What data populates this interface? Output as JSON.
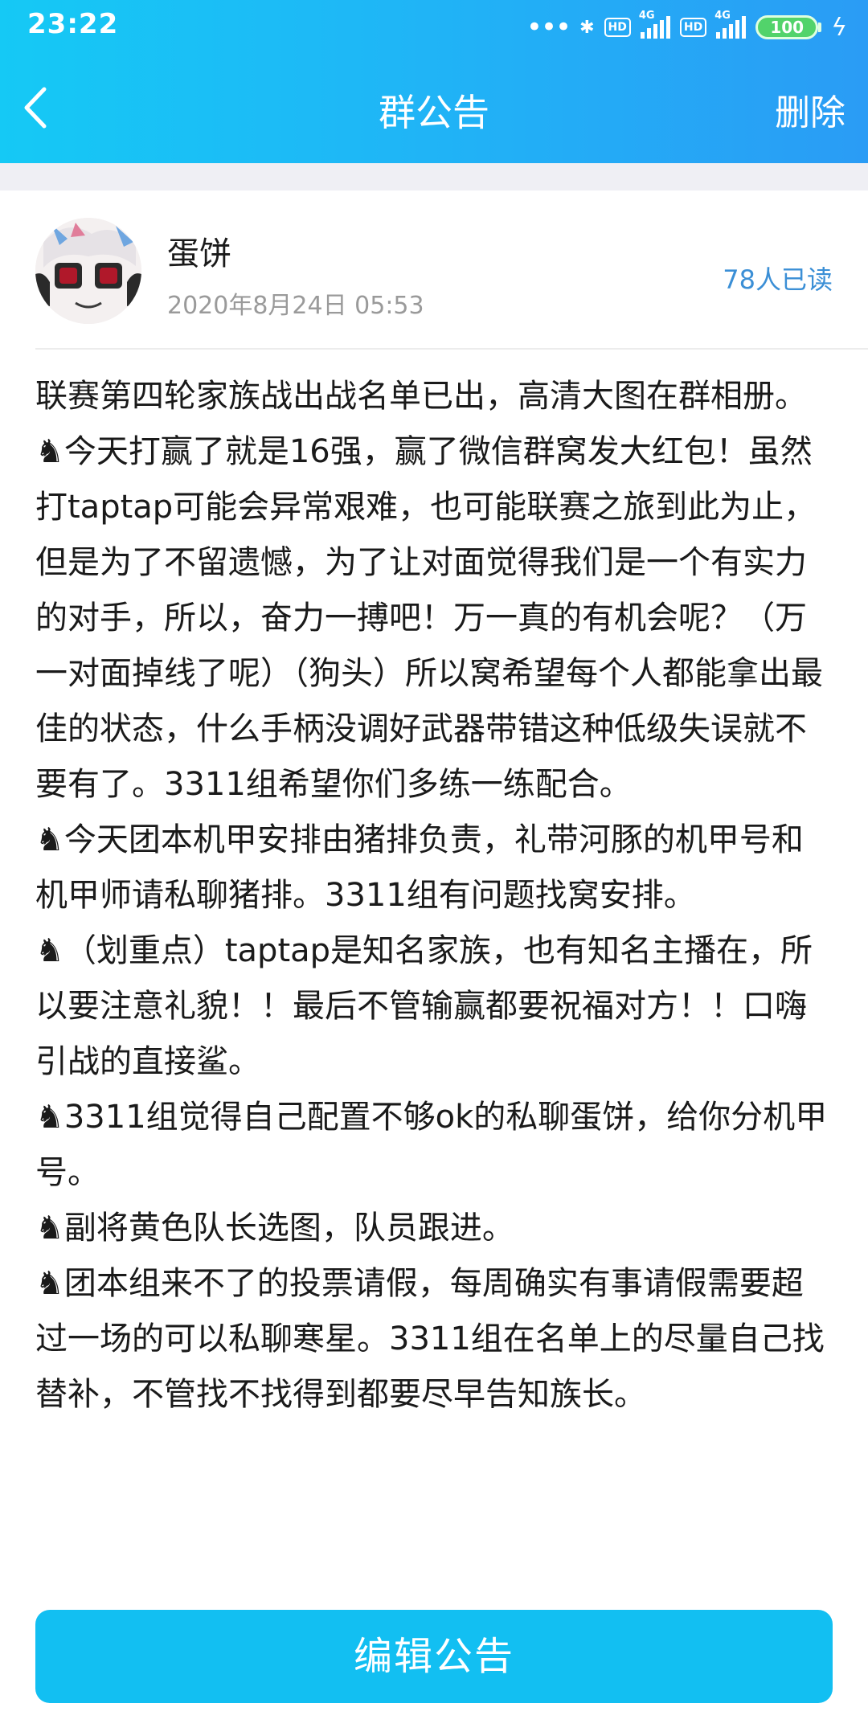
{
  "status_bar": {
    "time": "23:22",
    "dots": "•••",
    "hd1": "HD",
    "net1": "4G",
    "hd2": "HD",
    "net2": "4G",
    "battery": "100",
    "bluetooth": "✱",
    "charging": "ϟ"
  },
  "nav": {
    "title": "群公告",
    "delete_label": "删除"
  },
  "post": {
    "author": "蛋饼",
    "datetime": "2020年8月24日 05:53",
    "read_count": "78人已读",
    "content": "联赛第四轮家族战出战名单已出，高清大图在群相册。\n♞今天打赢了就是16强，赢了微信群窝发大红包！虽然打taptap可能会异常艰难，也可能联赛之旅到此为止，但是为了不留遗憾，为了让对面觉得我们是一个有实力的对手，所以，奋力一搏吧！万一真的有机会呢？（万一对面掉线了呢）（狗头）所以窝希望每个人都能拿出最佳的状态，什么手柄没调好武器带错这种低级失误就不要有了。3311组希望你们多练一练配合。\n♞今天团本机甲安排由猪排负责，礼带河豚的机甲号和机甲师请私聊猪排。3311组有问题找窝安排。\n♞（划重点）taptap是知名家族，也有知名主播在，所以要注意礼貌！！最后不管输赢都要祝福对方！！口嗨引战的直接鲨。\n♞3311组觉得自己配置不够ok的私聊蛋饼，给你分机甲号。\n♞副将黄色队长选图，队员跟进。\n♞团本组来不了的投票请假，每周确实有事请假需要超过一场的可以私聊寒星。3311组在名单上的尽量自己找替补，不管找不找得到都要尽早告知族长。"
  },
  "actions": {
    "edit_label": "编辑公告"
  },
  "colors": {
    "header_start": "#15c9f5",
    "header_end": "#2a9cf5",
    "button": "#12bff2",
    "read_count": "#3b8fd6"
  }
}
